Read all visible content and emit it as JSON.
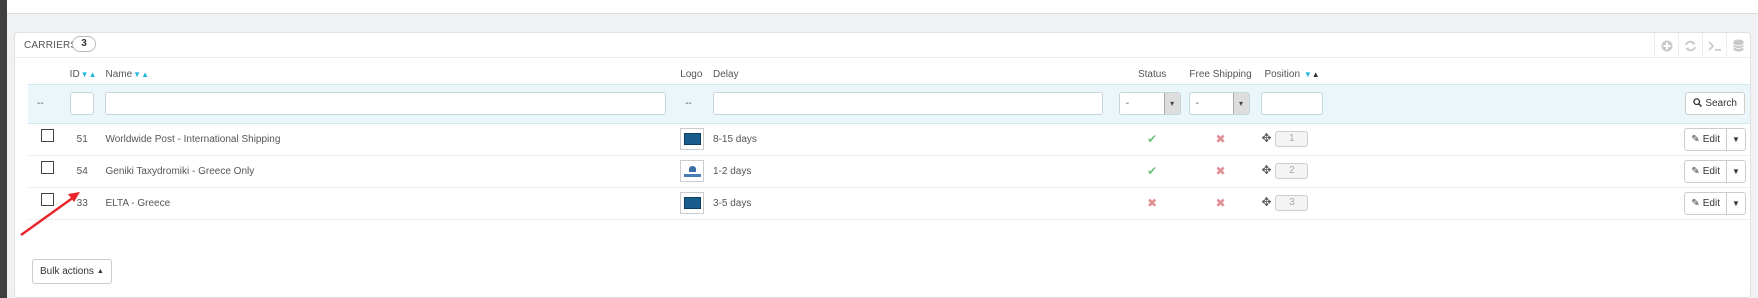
{
  "panel": {
    "title": "CARRIERS",
    "count": "3"
  },
  "toolbar": {
    "icons": [
      "add-icon",
      "refresh-icon",
      "sql-query-icon",
      "database-export-icon"
    ]
  },
  "columns": {
    "id": "ID",
    "name": "Name",
    "logo": "Logo",
    "delay": "Delay",
    "status": "Status",
    "free_shipping": "Free Shipping",
    "position": "Position"
  },
  "filters": {
    "bulk_placeholder": "--",
    "logo_placeholder": "--",
    "status_value": "-",
    "free_shipping_value": "-",
    "search_label": "Search"
  },
  "rows": [
    {
      "id": "51",
      "name": "Worldwide Post - International Shipping",
      "logo": "blue-logo",
      "delay": "8-15 days",
      "status": "enabled",
      "free_shipping": "no",
      "position": "1"
    },
    {
      "id": "54",
      "name": "Geniki Taxydromiki - Greece Only",
      "logo": "white-logo",
      "delay": "1-2 days",
      "status": "enabled",
      "free_shipping": "no",
      "position": "2"
    },
    {
      "id": "33",
      "name": "ELTA - Greece",
      "logo": "blue-logo",
      "delay": "3-5 days",
      "status": "disabled",
      "free_shipping": "no",
      "position": "3"
    }
  ],
  "row_action": "Edit",
  "bulk_actions_label": "Bulk actions",
  "colors": {
    "accent": "#25b9d7",
    "enabled": "#72c279",
    "disabled": "#e08f95",
    "annotation_arrow": "#e8262b"
  }
}
